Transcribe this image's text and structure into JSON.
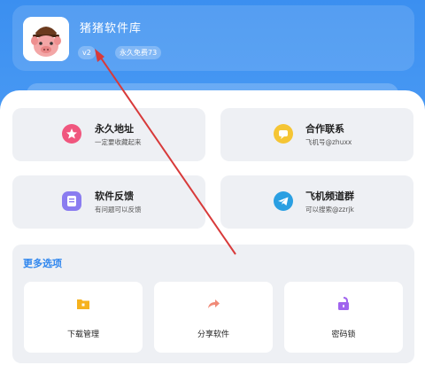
{
  "header": {
    "app_name": "猪猪软件库",
    "version_chip": "v2",
    "permanent_chip": "永久免费73",
    "icon": "pig-logo"
  },
  "tiles": [
    {
      "title": "永久地址",
      "subtitle": "一定要收藏起来",
      "icon": "star-icon",
      "color": "#f0567e"
    },
    {
      "title": "合作联系",
      "subtitle": "飞机号@zhuxx",
      "icon": "chat-icon",
      "color": "#f5c534"
    },
    {
      "title": "软件反馈",
      "subtitle": "有问题可以反馈",
      "icon": "feedback-icon",
      "color": "#8a7cf0"
    },
    {
      "title": "飞机频道群",
      "subtitle": "可以搜索@zzrjk",
      "icon": "telegram-icon",
      "color": "#2a9fe2"
    }
  ],
  "more": {
    "title": "更多选项",
    "options": [
      {
        "label": "下载管理",
        "icon": "folder-icon",
        "color": "#f6b21e"
      },
      {
        "label": "分享软件",
        "icon": "share-icon",
        "color": "#f08a78"
      },
      {
        "label": "密码锁",
        "icon": "unlock-icon",
        "color": "#a064ee"
      }
    ]
  },
  "colors": {
    "header_blue": "#3b8ff0",
    "accent": "#2f86ee",
    "annotation_arrow": "#d83a3a"
  }
}
